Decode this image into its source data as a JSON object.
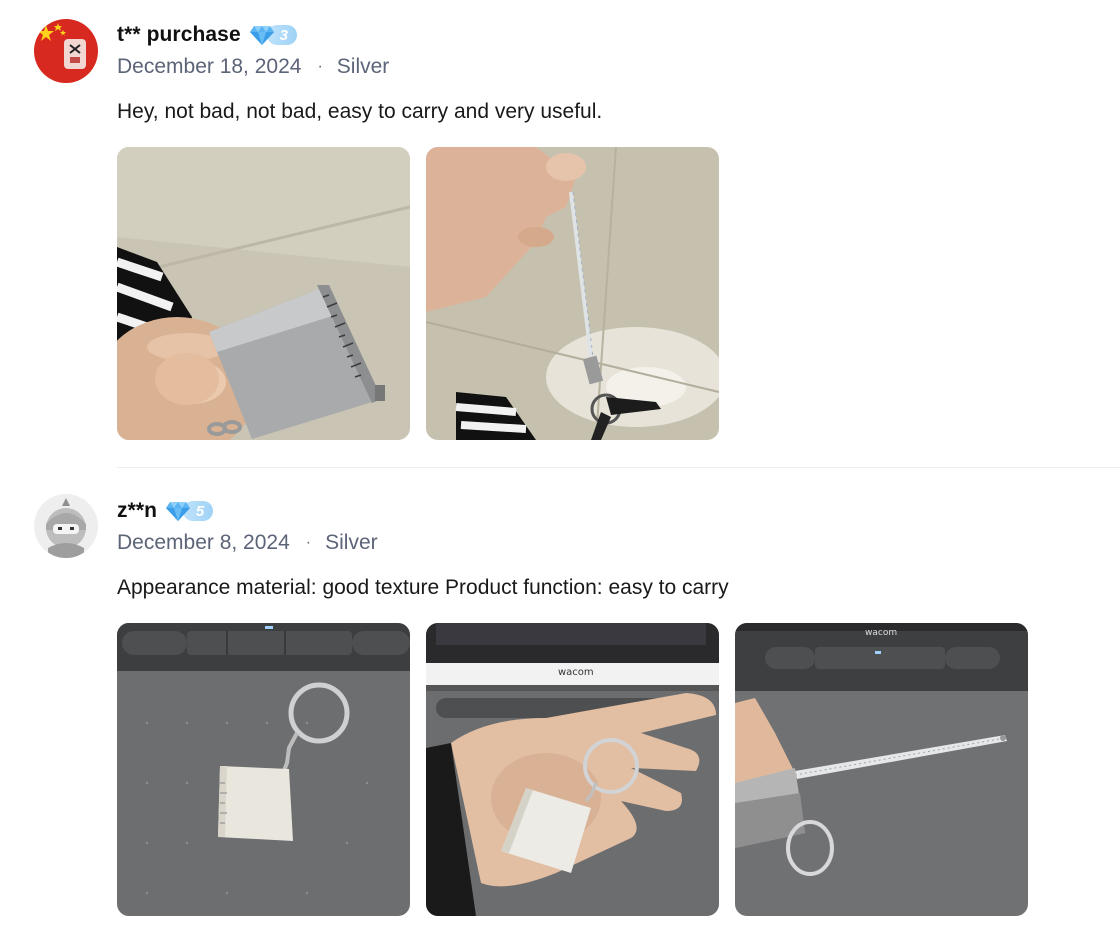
{
  "reviews": [
    {
      "username": "t** purchase",
      "level": "3",
      "date": "December 18, 2024",
      "variant": "Silver",
      "text": "Hey, not bad, not bad, easy to carry and very useful.",
      "photos": [
        "photo-ruler-card-in-hand",
        "photo-tape-extended-from-hand"
      ]
    },
    {
      "username": "z**n",
      "level": "5",
      "date": "December 8, 2024",
      "variant": "Silver",
      "text": "Appearance material: good texture Product function: easy to carry",
      "photos": [
        "photo-keychain-on-tablet",
        "photo-keychain-in-palm",
        "photo-tape-pulled-out"
      ]
    }
  ],
  "colors": {
    "badge_gem": "#5bb4f2",
    "badge_pill": "#a9d8f8",
    "meta_text": "#5c6478"
  },
  "icons": {
    "level_badge": "diamond-gem-icon",
    "avatar_1": "china-flag-avatar",
    "avatar_2": "ninja-cartoon-avatar"
  }
}
